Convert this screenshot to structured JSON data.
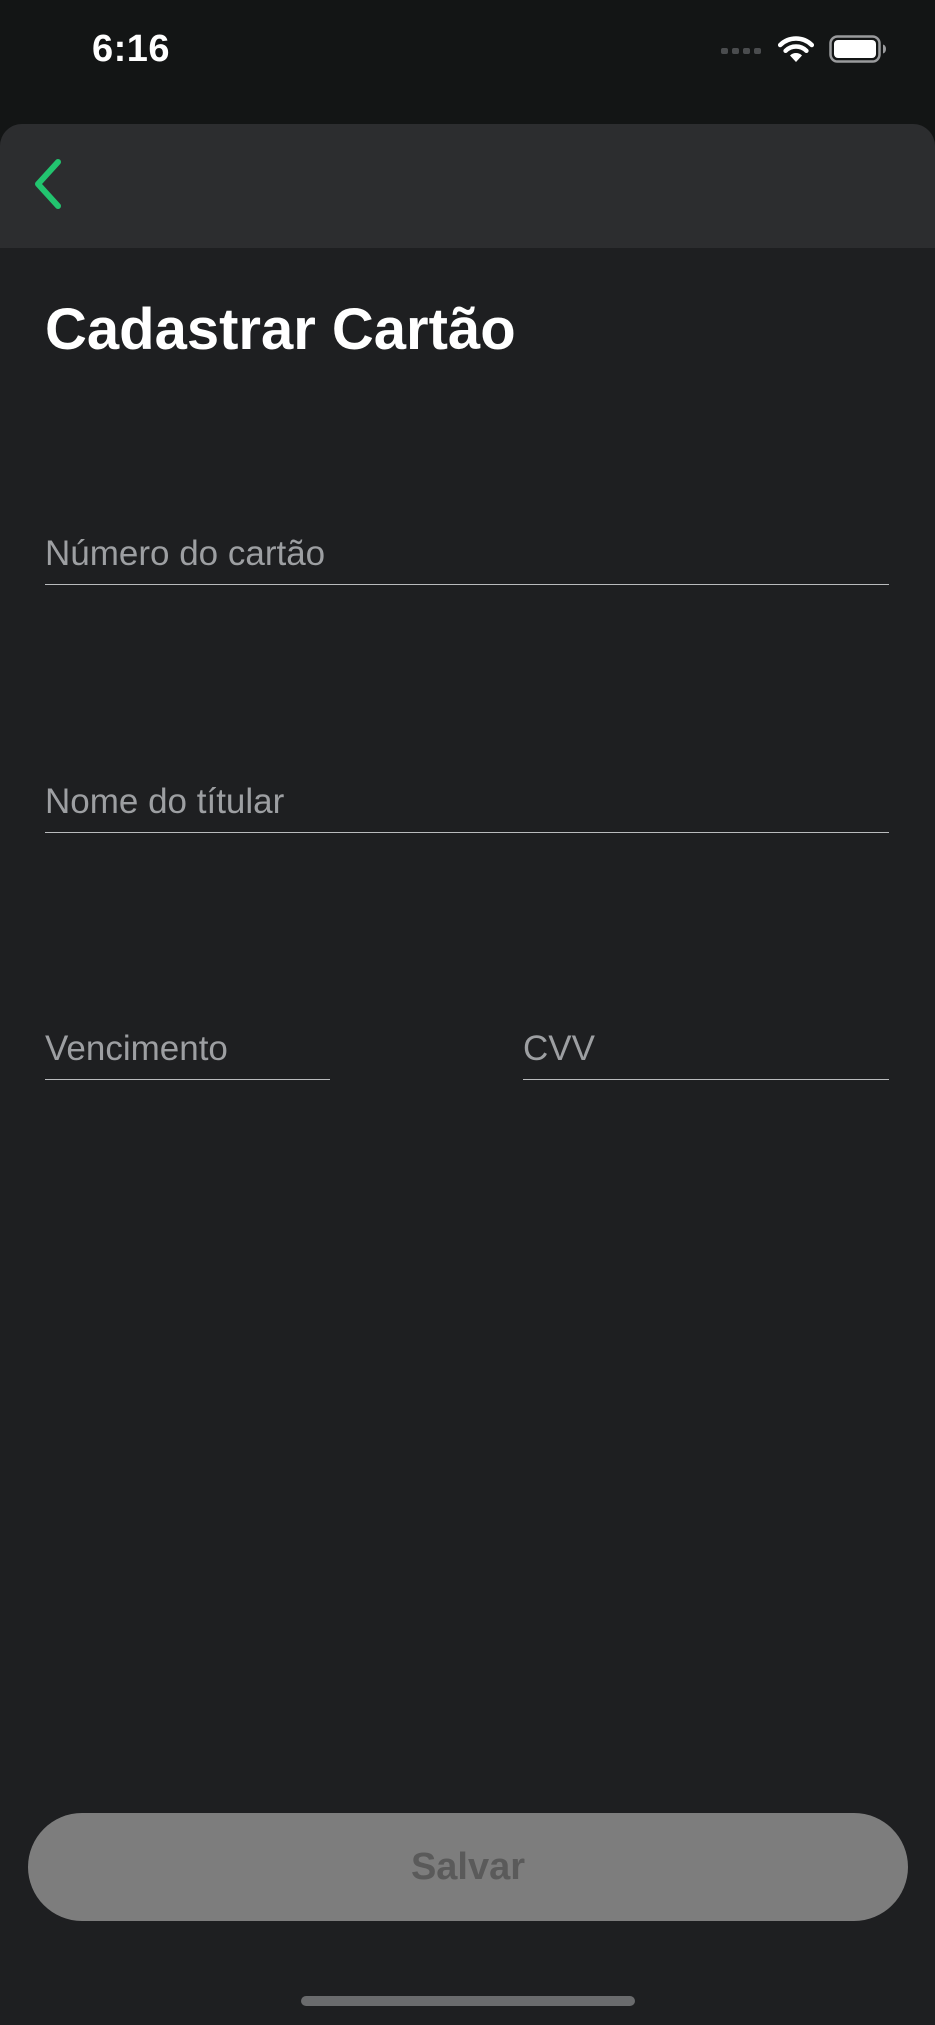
{
  "status_bar": {
    "time": "6:16",
    "icons": [
      "cellular-signal-icon",
      "wifi-icon",
      "battery-icon"
    ]
  },
  "nav": {
    "back_icon": "chevron-left-icon",
    "accent_color": "#22c46f"
  },
  "page": {
    "title": "Cadastrar Cartão"
  },
  "form": {
    "card_number": {
      "placeholder": "Número do cartão",
      "value": ""
    },
    "holder_name": {
      "placeholder": "Nome do títular",
      "value": ""
    },
    "expiry": {
      "placeholder": "Vencimento",
      "value": ""
    },
    "cvv": {
      "placeholder": "CVV",
      "value": ""
    }
  },
  "actions": {
    "save_label": "Salvar",
    "save_disabled": true
  }
}
